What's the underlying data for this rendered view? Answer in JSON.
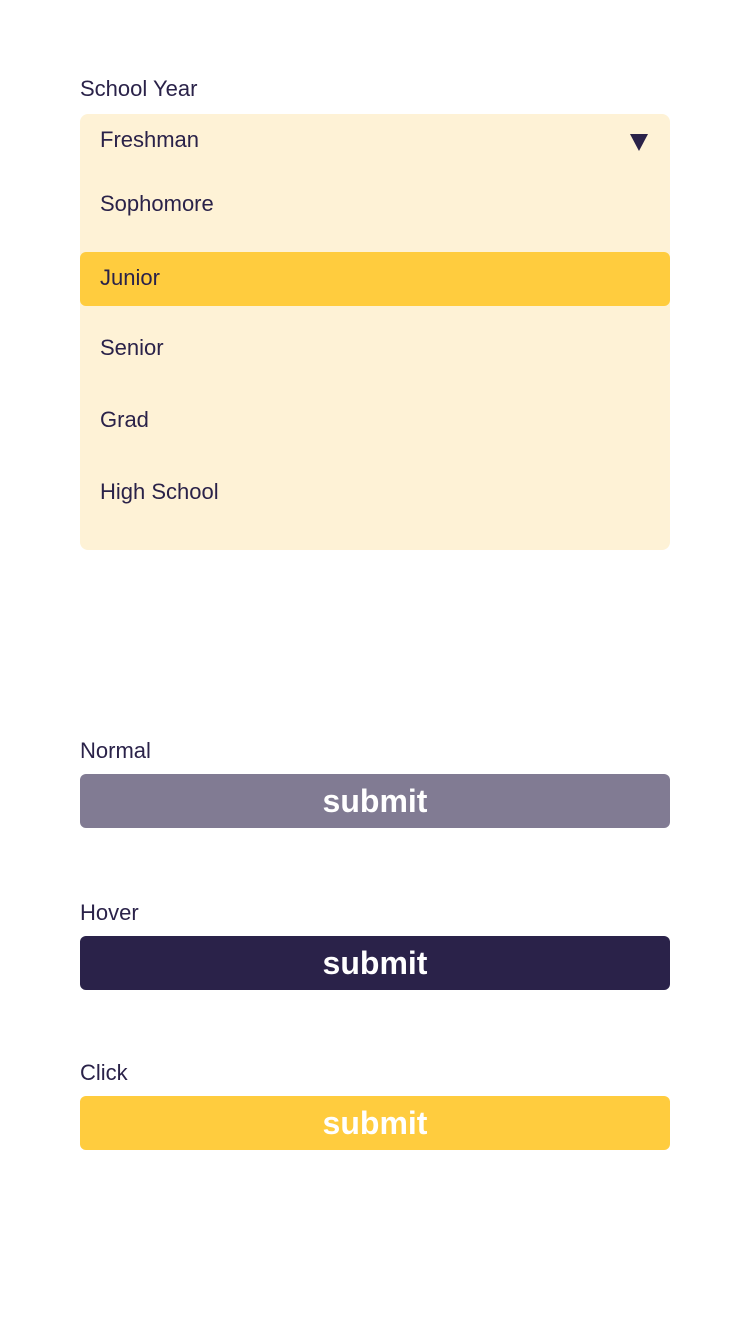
{
  "school_year": {
    "label": "School Year",
    "selected_value": "Freshman",
    "options": [
      {
        "label": "Sophomore",
        "highlighted": false
      },
      {
        "label": "Junior",
        "highlighted": true
      },
      {
        "label": "Senior",
        "highlighted": false
      },
      {
        "label": "Grad",
        "highlighted": false
      },
      {
        "label": "High School",
        "highlighted": false
      }
    ]
  },
  "button_states": {
    "normal": {
      "label": "Normal",
      "button_text": "submit",
      "color": "#817b93"
    },
    "hover": {
      "label": "Hover",
      "button_text": "submit",
      "color": "#2a2249"
    },
    "click": {
      "label": "Click",
      "button_text": "submit",
      "color": "#ffcc3e"
    }
  },
  "colors": {
    "text": "#2a2249",
    "dropdown_background": "#fef2d6",
    "highlight": "#ffcc3e"
  }
}
